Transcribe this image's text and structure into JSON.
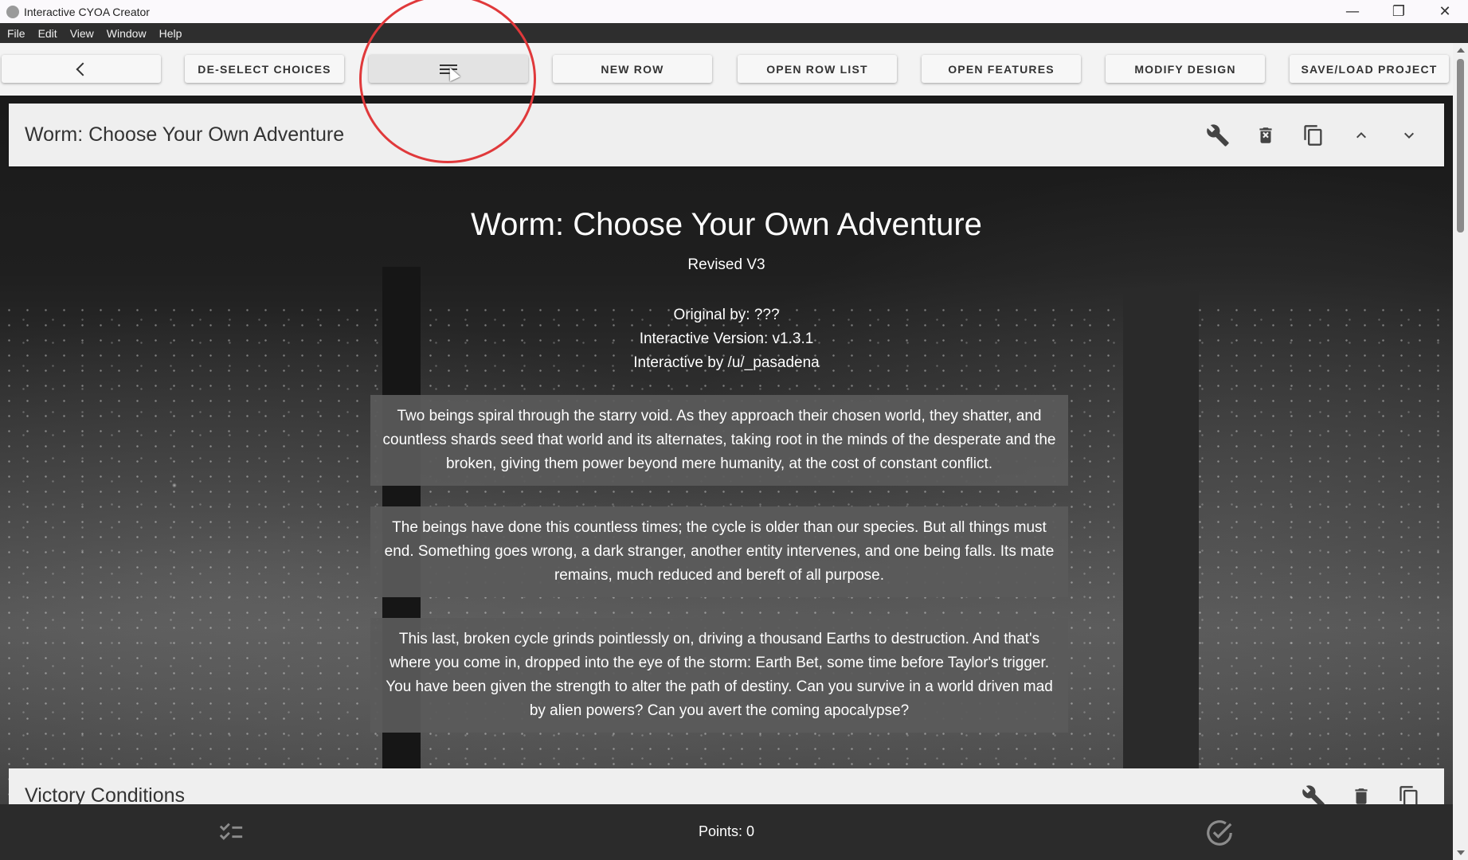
{
  "window": {
    "title": "Interactive CYOA Creator",
    "controls": {
      "minimize": "—",
      "restore": "❐",
      "close": "✕"
    }
  },
  "menu": [
    "File",
    "Edit",
    "View",
    "Window",
    "Help"
  ],
  "toolbar": {
    "back_icon": "chevron-left-icon",
    "deselect": "DE-SELECT CHOICES",
    "menu_icon": "menu-lines-icon",
    "new_row": "NEW ROW",
    "open_row_list": "OPEN ROW LIST",
    "open_features": "OPEN FEATURES",
    "modify_design": "MODIFY DESIGN",
    "save_load": "SAVE/LOAD PROJECT"
  },
  "row1": {
    "header_title": "Worm: Choose Your Own Adventure",
    "tools": [
      "wrench-icon",
      "delete-icon",
      "copy-icon",
      "chevron-up-icon",
      "chevron-down-icon"
    ],
    "title": "Worm: Choose Your Own Adventure",
    "subtitle": "Revised V3",
    "credits": [
      "Original by: ???",
      "Interactive Version: v1.3.1",
      "Interactive by /u/_pasadena"
    ],
    "paragraphs": [
      "Two beings spiral through the starry void. As they approach their chosen world, they shatter, and countless shards seed that world and its alternates, taking root in the minds of the desperate and the broken, giving them power beyond mere humanity, at the cost of constant conflict.",
      "The beings have done this countless times; the cycle is older than our species. But all things must end. Something goes wrong, a dark stranger, another entity intervenes, and one being falls. Its mate remains, much reduced and bereft of all purpose.",
      "This last, broken cycle grinds pointlessly on, driving a thousand Earths to destruction. And that's where you come in, dropped into the eye of the storm: Earth Bet, some time before Taylor's trigger. You have been given the strength to alter the path of destiny. Can you survive in a world driven mad by alien powers? Can you avert the coming apocalypse?"
    ]
  },
  "row2": {
    "header_title": "Victory Conditions"
  },
  "bottom": {
    "points": "Points: 0"
  },
  "colors": {
    "menubar": "#2e2e2e",
    "bottombar": "#2b2b2b",
    "highlight": "#e0393b",
    "textbox": "#5a5a5a"
  }
}
